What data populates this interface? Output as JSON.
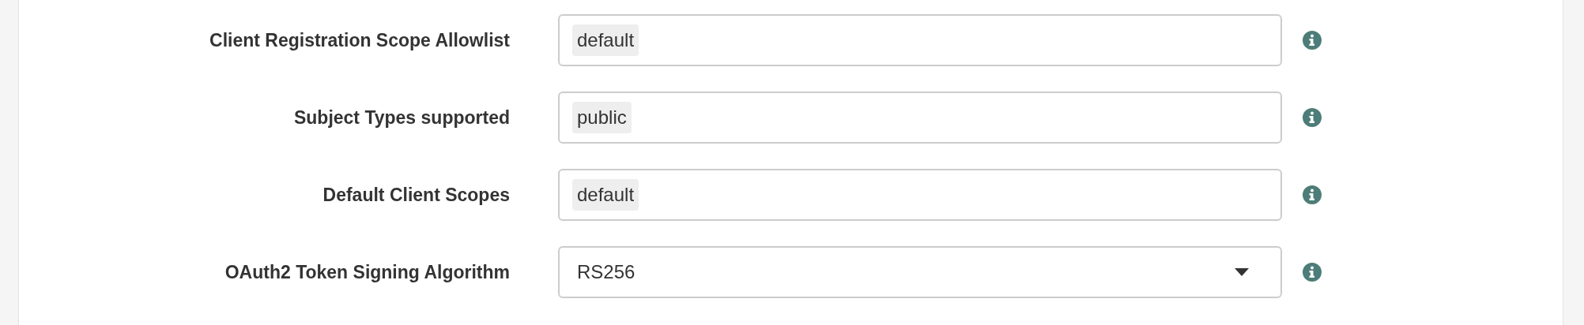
{
  "fields": [
    {
      "label": "Client Registration Scope Allowlist",
      "kind": "tags",
      "tags": [
        "default"
      ]
    },
    {
      "label": "Subject Types supported",
      "kind": "tags",
      "tags": [
        "public"
      ]
    },
    {
      "label": "Default Client Scopes",
      "kind": "tags",
      "tags": [
        "default"
      ]
    },
    {
      "label": "OAuth2 Token Signing Algorithm",
      "kind": "select",
      "value": "RS256"
    }
  ]
}
